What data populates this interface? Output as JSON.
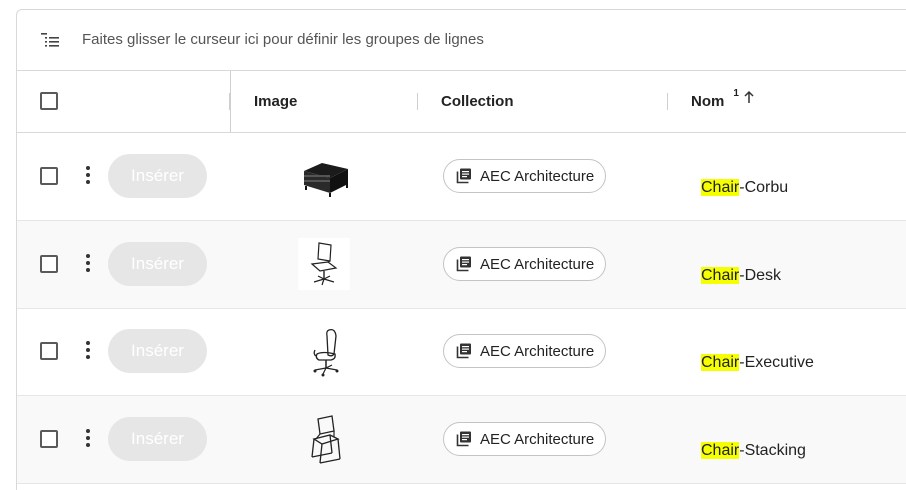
{
  "group_bar": {
    "icon": "row-group-icon",
    "text": "Faites glisser le curseur ici pour définir les groupes de lignes"
  },
  "header": {
    "image": "Image",
    "collection": "Collection",
    "name": "Nom",
    "name_sort_index": "1",
    "name_sort_icon": "arrow-up-icon"
  },
  "rows": [
    {
      "insert_label": "Insérer",
      "collection": "AEC Architecture",
      "name_highlight": "Chair",
      "name_rest": "-Corbu",
      "thumbnail": "armchair-thumbnail"
    },
    {
      "insert_label": "Insérer",
      "collection": "AEC Architecture",
      "name_highlight": "Chair",
      "name_rest": "-Desk",
      "thumbnail": "desk-chair-thumbnail"
    },
    {
      "insert_label": "Insérer",
      "collection": "AEC Architecture",
      "name_highlight": "Chair",
      "name_rest": "-Executive",
      "thumbnail": "executive-chair-thumbnail"
    },
    {
      "insert_label": "Insérer",
      "collection": "AEC Architecture",
      "name_highlight": "Chair",
      "name_rest": "-Stacking",
      "thumbnail": "stacking-chair-thumbnail"
    }
  ],
  "colors": {
    "highlight": "#f5ff00",
    "insert_disabled_bg": "#e6e6e6"
  }
}
